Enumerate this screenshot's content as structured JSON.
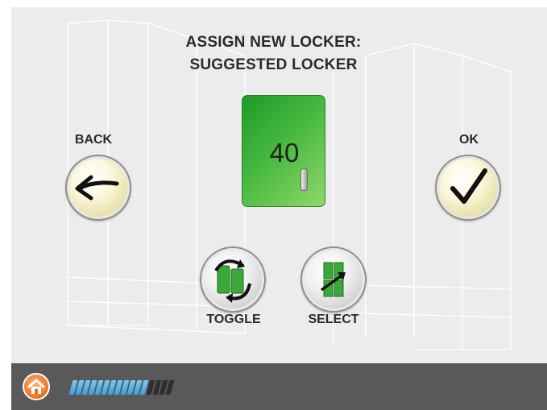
{
  "screen": {
    "title_line1": "ASSIGN NEW LOCKER:",
    "title_line2": "SUGGESTED LOCKER"
  },
  "back": {
    "label": "BACK",
    "icon": "arrow-left-icon"
  },
  "ok": {
    "label": "OK",
    "icon": "checkmark-icon"
  },
  "locker": {
    "number": "40",
    "color": "#46b83f",
    "icon": "locker-door-icon"
  },
  "toggle": {
    "label": "TOGGLE",
    "icon": "toggle-lockers-icon"
  },
  "select": {
    "label": "SELECT",
    "icon": "select-locker-icon"
  },
  "footer": {
    "home_icon": "home-icon",
    "progress": {
      "filled_segments": 12,
      "total_segments": 16,
      "fill_color": "#3aa0e0",
      "empty_color": "#2f2f2f"
    }
  }
}
